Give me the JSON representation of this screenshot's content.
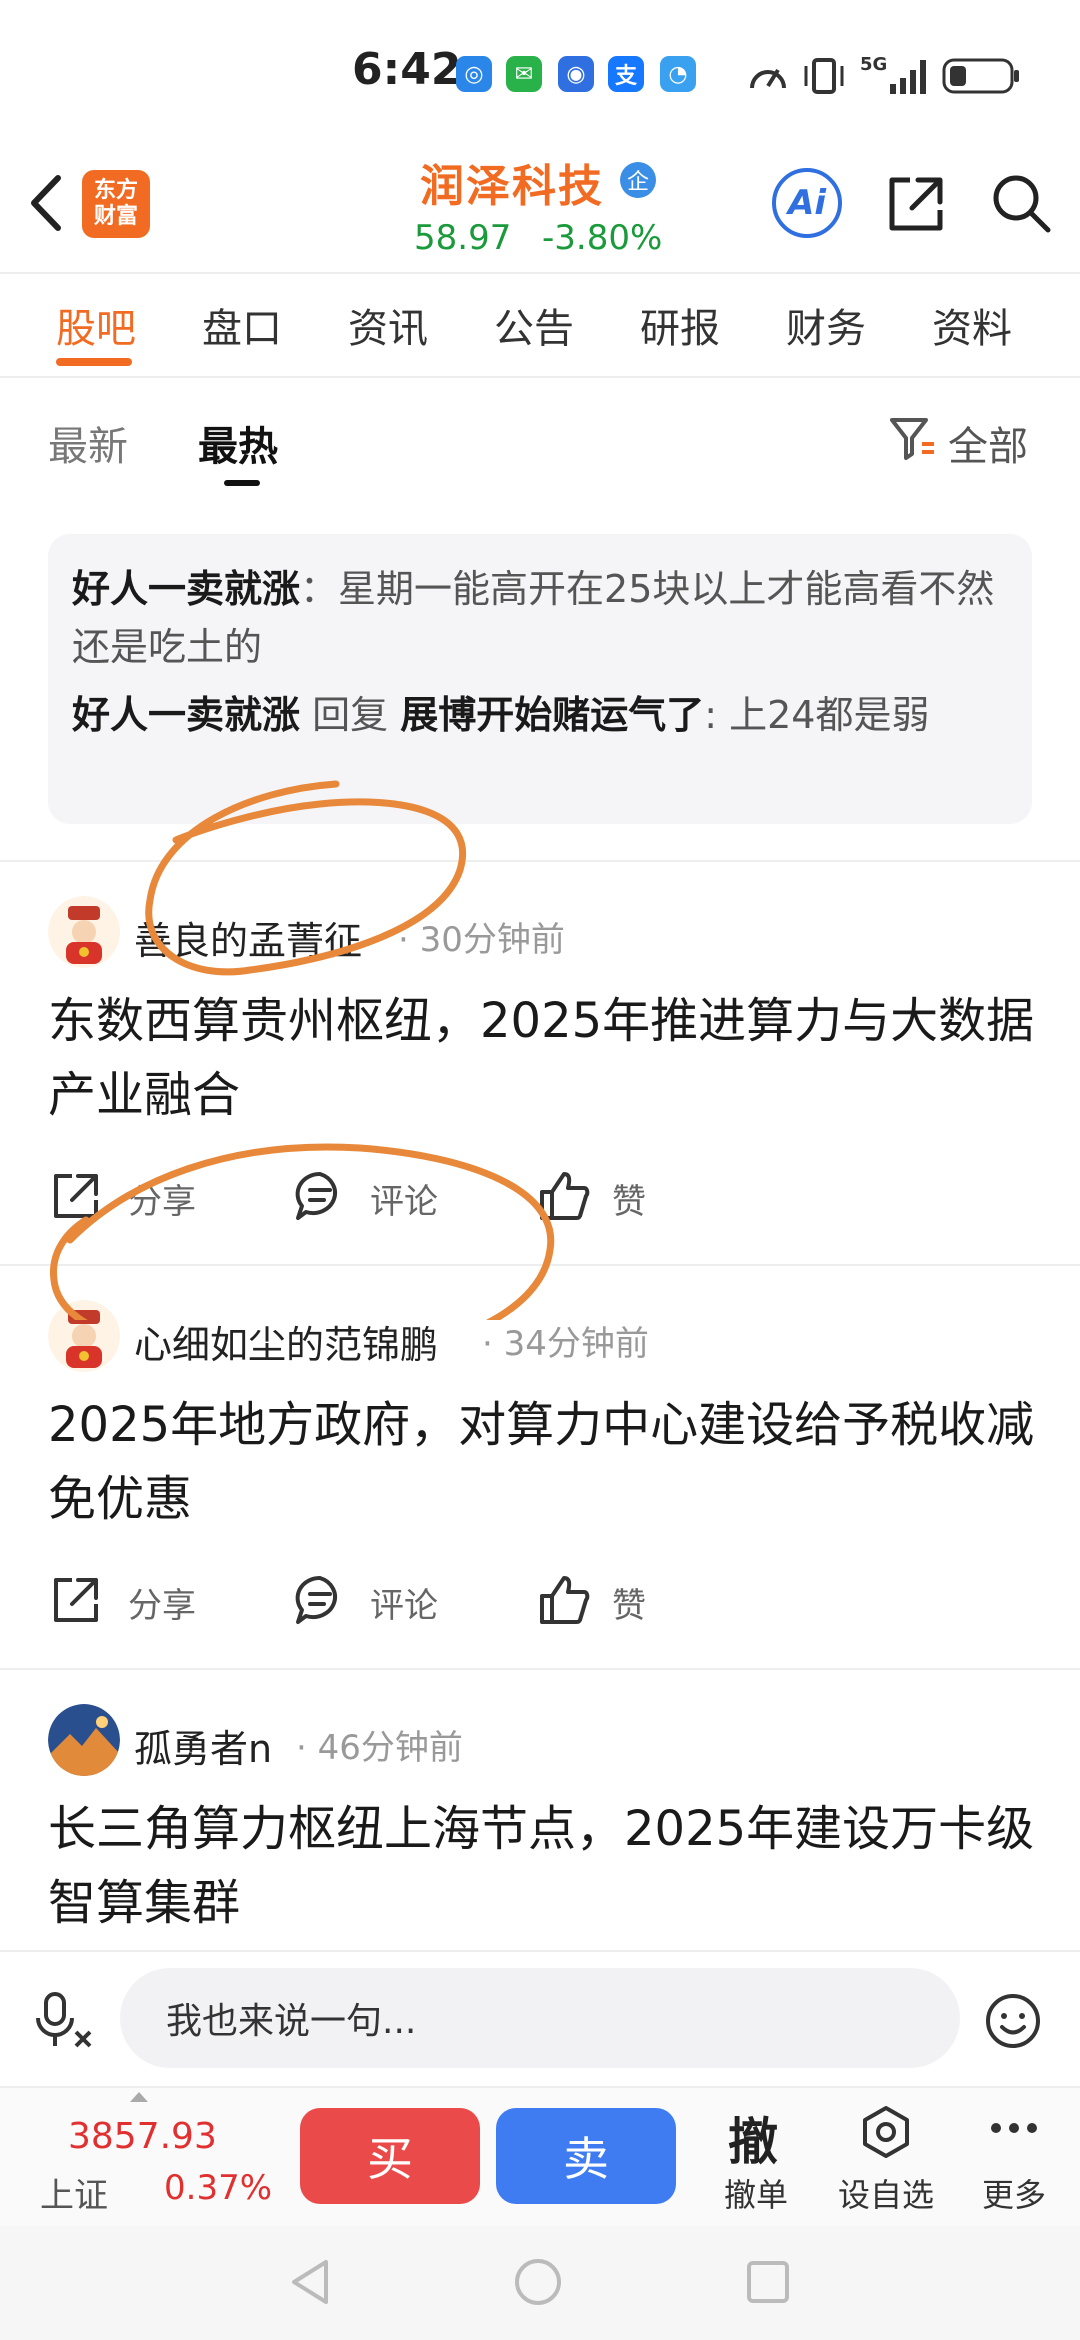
{
  "status_bar": {
    "time": "6:42",
    "network": "5G"
  },
  "header": {
    "app_logo_line1": "东方",
    "app_logo_line2": "财富",
    "stock_name": "润泽科技",
    "badge": "企",
    "price": "58.97",
    "change_pct": "-3.80%",
    "ai_label": "Ai"
  },
  "tabs": [
    {
      "label": "股吧"
    },
    {
      "label": "盘口"
    },
    {
      "label": "资讯"
    },
    {
      "label": "公告"
    },
    {
      "label": "研报"
    },
    {
      "label": "财务"
    },
    {
      "label": "资料"
    }
  ],
  "sort": {
    "latest": "最新",
    "hottest": "最热",
    "filter": "全部"
  },
  "featured_comment": {
    "user1": "好人一卖就涨",
    "text1": "：星期一能高开在25块以上才能高看不然还是吃土的",
    "user2": "好人一卖就涨",
    "reply_word": "回复",
    "reply_target": "展博开始赌运气了",
    "text2": ": 上24都是弱"
  },
  "posts": [
    {
      "author": "善良的孟菁征",
      "time": "· 30分钟前",
      "title": "东数西算贵州枢纽，2025年推进算力与大数据产业融合",
      "share": "分享",
      "comment": "评论",
      "like": "赞"
    },
    {
      "author": "心细如尘的范锦鹏",
      "time": "· 34分钟前",
      "title": "2025年地方政府，对算力中心建设给予税收减免优惠",
      "share": "分享",
      "comment": "评论",
      "like": "赞"
    },
    {
      "author": "孤勇者n",
      "time": "· 46分钟前",
      "title": "长三角算力枢纽上海节点，2025年建设万卡级智算集群"
    }
  ],
  "reply_bar": {
    "placeholder": "我也来说一句..."
  },
  "trade_bar": {
    "index_value": "3857.93",
    "index_name": "上证",
    "index_change": "0.37%",
    "buy": "买",
    "sell": "卖",
    "cancel_icon_text": "撤",
    "cancel_label": "撤单",
    "watchlist_label": "设自选",
    "more_label": "更多"
  },
  "colors": {
    "brand_orange": "#f26b22",
    "down_green": "#1a9a3a",
    "up_red": "#e03030",
    "buy_red": "#ea4a4a",
    "sell_blue": "#3f7cf2",
    "ai_blue": "#2f6fe0"
  }
}
